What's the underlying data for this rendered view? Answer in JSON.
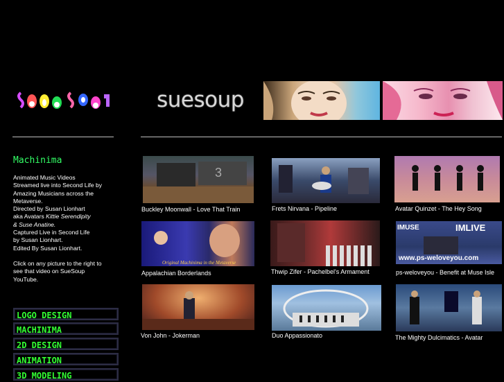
{
  "logo": {
    "text": "SUESOUP"
  },
  "banner": {
    "title": "suesoup"
  },
  "sidebar": {
    "title": "Machinima",
    "desc": {
      "l1": "Animated Music Videos",
      "l2": "Streamed live into Second Life by",
      "l3": "Amazing Musicians across the",
      "l4": "Metaverse.",
      "l5": "Directed by Susan Lionhart",
      "l6a": "aka Avatars ",
      "l6b": "Kittie Serendipity",
      "l7": "& Suse Anatine.",
      "l8": "Captured Live in Second Life",
      "l9": "by Susan Lionhart.",
      "l10": "Edited By Susan Lionhart.",
      "l11": "Click on any picture to the right to",
      "l12": "see that video on  SueSoup",
      "l13": "YouTube."
    },
    "nav": [
      "LOGO DESIGN",
      "MACHINIMA",
      "2D DESIGN",
      "ANIMATION",
      "3D MODELING"
    ]
  },
  "videos": [
    {
      "caption": "Buckley Moonwall - Love That Train",
      "color": "#5a4a3a"
    },
    {
      "caption": "Frets Nirvana - Pipeline",
      "color": "#3a4660"
    },
    {
      "caption": "Avatar Quinzet - The Hey Song",
      "color": "#6a4a7a"
    },
    {
      "caption": "Appalachian Borderlands",
      "color": "#2a2a6a"
    },
    {
      "caption": "Thwip Zifer - Pachelbel's Armament",
      "color": "#4a2a2a"
    },
    {
      "caption": "ps-weloveyou - Benefit at Muse Isle",
      "color": "#2a3a5a"
    },
    {
      "caption": "Von John - Jokerman",
      "color": "#6a3a2a"
    },
    {
      "caption": "Duo Appassionato",
      "color": "#4a6a8a"
    },
    {
      "caption": "The Mighty Dulcimatics - Avatar",
      "color": "#3a5a7a"
    }
  ],
  "thumb_overlays": {
    "t4": "Original Machinima in the Metaverse",
    "t6a": "IMUSE",
    "t6b": "IMLIVE",
    "t6c": "www.ps-weloveyou.com"
  }
}
